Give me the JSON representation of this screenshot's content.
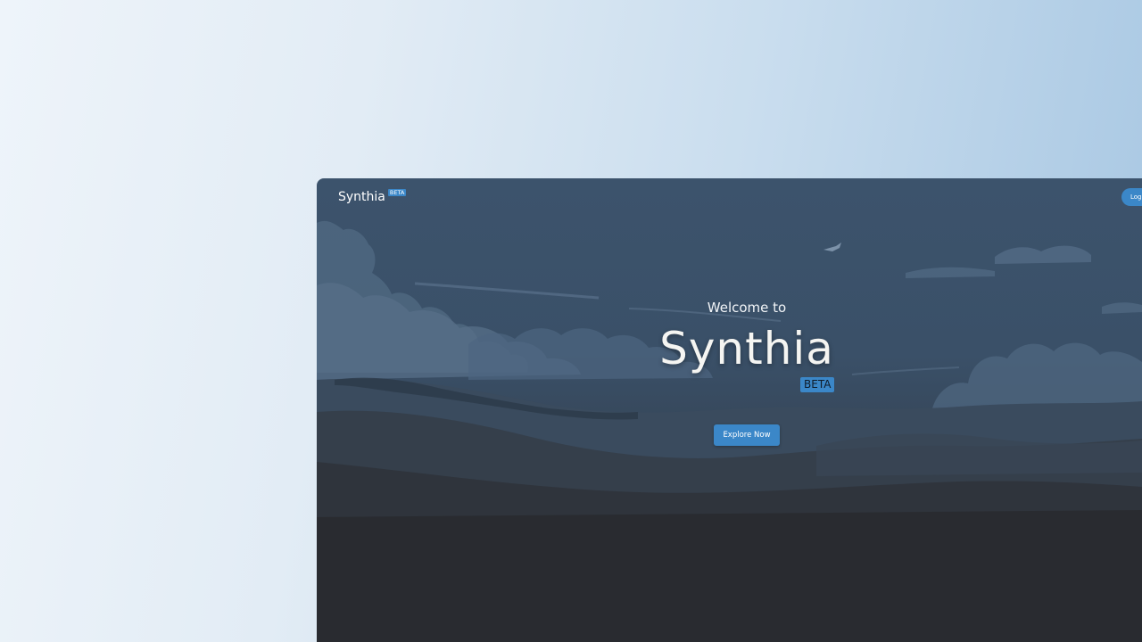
{
  "header": {
    "logo_text": "Synthia",
    "beta_badge": "BETA",
    "login_label": "Log"
  },
  "hero": {
    "welcome_text": "Welcome to",
    "title": "Synthia",
    "beta_badge": "BETA",
    "cta_label": "Explore Now"
  },
  "colors": {
    "accent": "#3b87c8",
    "sky_top": "#3c536c",
    "ground_bottom": "#27292d",
    "page_background": "#dce8f2"
  }
}
